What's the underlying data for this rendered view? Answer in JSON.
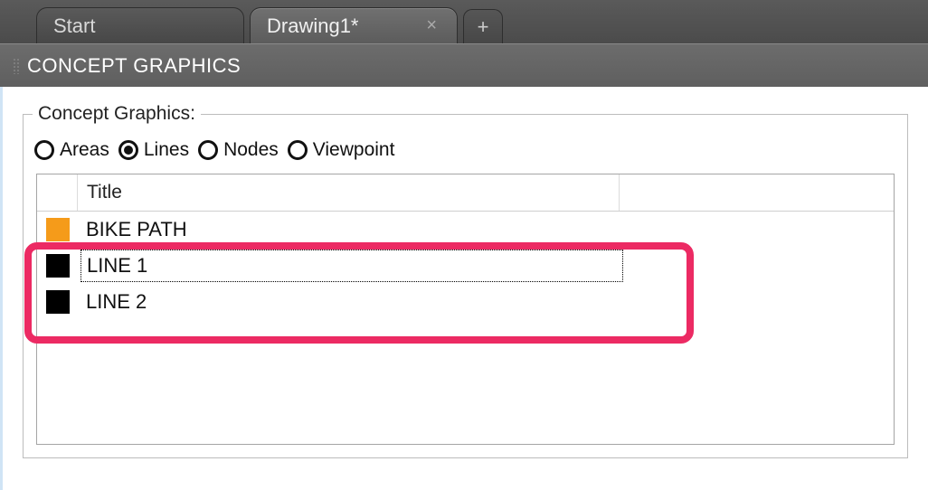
{
  "tabs": {
    "start": "Start",
    "drawing": "Drawing1*",
    "close_glyph": "×",
    "plus_glyph": "+"
  },
  "panel": {
    "title": "CONCEPT GRAPHICS"
  },
  "group": {
    "legend": "Concept Graphics:"
  },
  "radios": {
    "areas": "Areas",
    "lines": "Lines",
    "nodes": "Nodes",
    "viewpoint": "Viewpoint",
    "selected": "lines"
  },
  "list": {
    "header_title": "Title",
    "rows": [
      {
        "title": "BIKE PATH",
        "color": "#f59b1a",
        "selected": false
      },
      {
        "title": "LINE 1",
        "color": "#000000",
        "selected": true
      },
      {
        "title": "LINE 2",
        "color": "#000000",
        "selected": false
      }
    ]
  },
  "annotation": {
    "highlight_rows": [
      1,
      2
    ],
    "color": "#ec2a63"
  }
}
